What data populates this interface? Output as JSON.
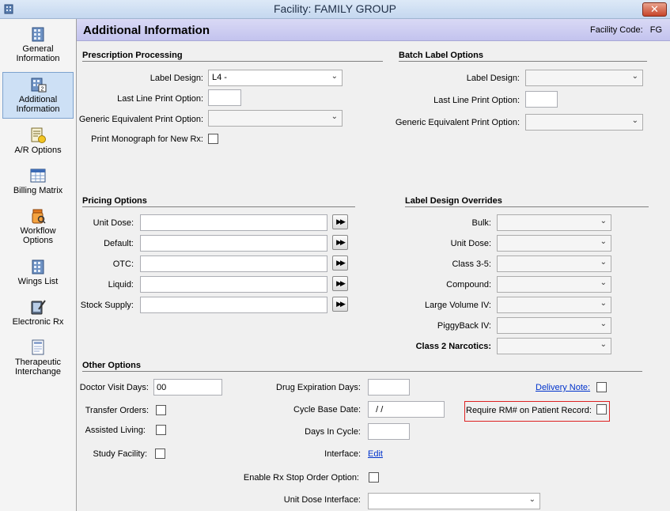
{
  "window": {
    "title": "Facility: FAMILY GROUP",
    "close_label": "✕"
  },
  "sidebar": {
    "items": [
      {
        "label_line1": "General",
        "label_line2": "Information",
        "icon": "building-icon"
      },
      {
        "label_line1": "Additional",
        "label_line2": "Information",
        "icon": "building-2-icon",
        "active": true
      },
      {
        "label_line1": "A/R Options",
        "label_line2": "",
        "icon": "ledger-coins-icon"
      },
      {
        "label_line1": "Billing Matrix",
        "label_line2": "",
        "icon": "calendar-grid-icon"
      },
      {
        "label_line1": "Workflow",
        "label_line2": "Options",
        "icon": "pill-bottle-icon"
      },
      {
        "label_line1": "Wings List",
        "label_line2": "",
        "icon": "building-icon"
      },
      {
        "label_line1": "Electronic Rx",
        "label_line2": "",
        "icon": "tablet-pen-icon"
      },
      {
        "label_line1": "Therapeutic",
        "label_line2": "Interchange",
        "icon": "document-icon"
      }
    ]
  },
  "header": {
    "title": "Additional Information",
    "facility_code_label": "Facility Code:",
    "facility_code": "FG"
  },
  "prescription": {
    "title": "Prescription Processing",
    "label_design_label": "Label Design:",
    "label_design_value": "L4 -",
    "last_line_label": "Last Line Print Option:",
    "last_line_value": "",
    "generic_label": "Generic Equivalent Print Option:",
    "generic_value": "",
    "monograph_label": "Print Monograph for New Rx:"
  },
  "batch": {
    "title": "Batch Label Options",
    "label_design_label": "Label Design:",
    "label_design_value": "",
    "last_line_label": "Last Line Print Option:",
    "last_line_value": "",
    "generic_label": "Generic Equivalent Print Option:",
    "generic_value": ""
  },
  "pricing": {
    "title": "Pricing Options",
    "fields": [
      {
        "label": "Unit Dose:",
        "value": ""
      },
      {
        "label": "Default:",
        "value": ""
      },
      {
        "label": "OTC:",
        "value": ""
      },
      {
        "label": "Liquid:",
        "value": ""
      },
      {
        "label": "Stock Supply:",
        "value": ""
      }
    ],
    "button_glyph": "▶▶"
  },
  "overrides": {
    "title": "Label Design Overrides",
    "fields": [
      {
        "label": "Bulk:",
        "value": ""
      },
      {
        "label": "Unit Dose:",
        "value": ""
      },
      {
        "label": "Class 3-5:",
        "value": ""
      },
      {
        "label": "Compound:",
        "value": ""
      },
      {
        "label": "Large Volume IV:",
        "value": ""
      },
      {
        "label": "PiggyBack IV:",
        "value": ""
      },
      {
        "label": "Class 2 Narcotics:",
        "value": ""
      }
    ]
  },
  "other": {
    "title": "Other Options",
    "doctor_visit_label": "Doctor Visit Days:",
    "doctor_visit_value": "00",
    "transfer_label": "Transfer Orders:",
    "assisted_label": "Assisted Living:",
    "study_label": "Study Facility:",
    "drug_exp_label": "Drug Expiration Days:",
    "drug_exp_value": "",
    "cycle_base_label": "Cycle Base Date:",
    "cycle_base_value": "  / /",
    "days_cycle_label": "Days In Cycle:",
    "days_cycle_value": "",
    "interface_label": "Interface:",
    "interface_link": "Edit",
    "stop_order_label": "Enable Rx Stop Order Option:",
    "unit_dose_iface_label": "Unit Dose Interface:",
    "unit_dose_iface_value": "",
    "delivery_note_link": "Delivery Note:",
    "require_rm_label": "Require RM# on Patient Record:"
  },
  "colors": {
    "highlight_border": "#dd2222",
    "active_nav": "#cde0f5",
    "header_bg": "#c8c8f0"
  }
}
